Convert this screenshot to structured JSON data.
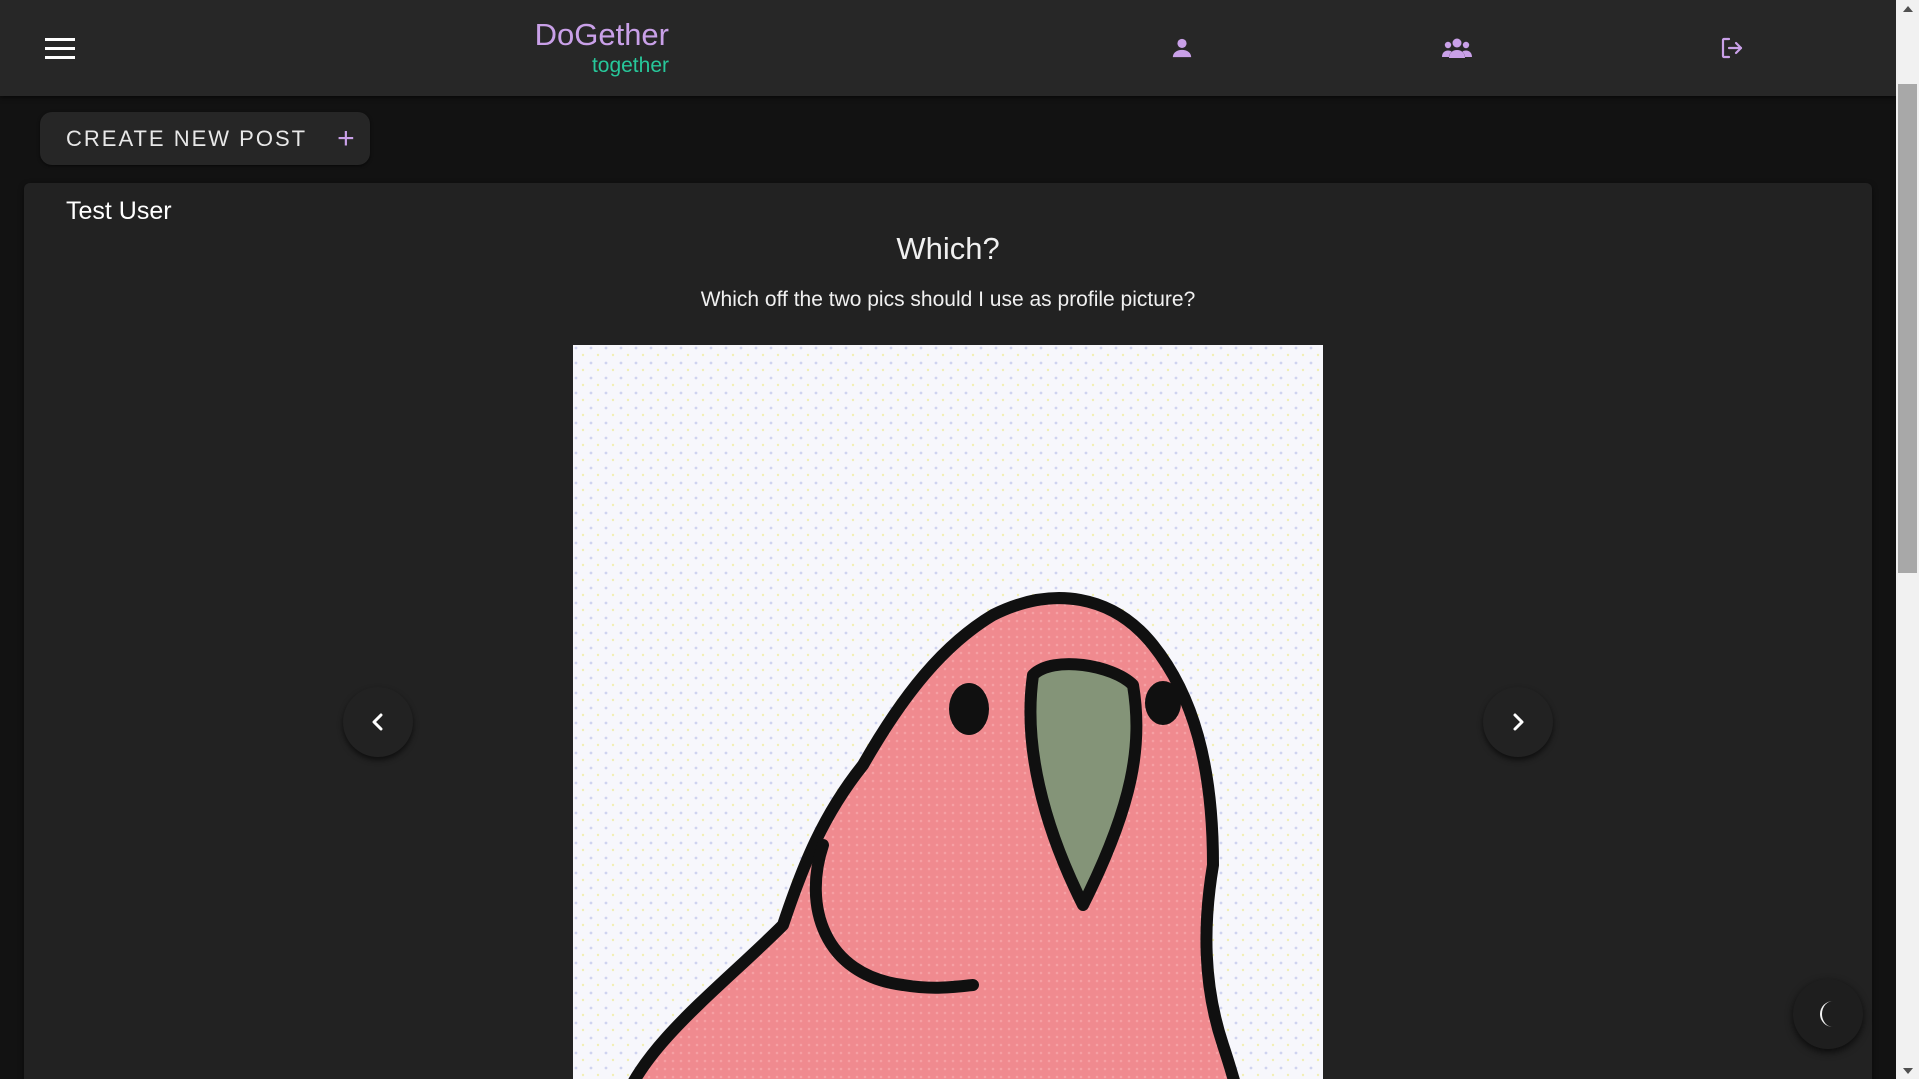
{
  "header": {
    "brand_title": "DoGether",
    "brand_subtitle": "together",
    "icons": [
      "menu-icon",
      "profile-icon",
      "groups-icon",
      "logout-icon"
    ]
  },
  "toolbar": {
    "create_label": "CREATE NEW POST",
    "create_icon": "+"
  },
  "post": {
    "author": "Test User",
    "title": "Which?",
    "body": "Which off the two pics should I use as profile picture?",
    "image_icon": "parrot-image"
  },
  "controls": {
    "prev_icon": "chevron-left-icon",
    "next_icon": "chevron-right-icon",
    "theme_icon": "moon-icon"
  },
  "colors": {
    "brand": "#c9a0e8",
    "accent": "#27c79a",
    "background": "#121212",
    "appbar": "#272727",
    "card": "#222222"
  }
}
